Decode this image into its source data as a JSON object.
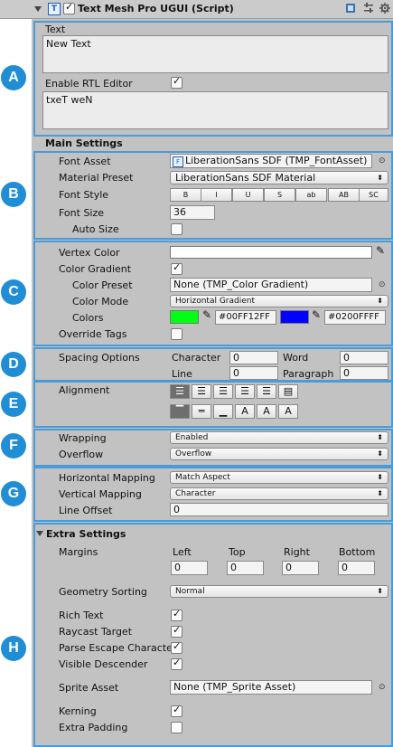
{
  "header": {
    "title": "Text Mesh Pro UGUI (Script)",
    "icon_letter": "T",
    "enabled": true,
    "icons": [
      "book-icon",
      "sliders-icon",
      "gear-icon"
    ]
  },
  "badges": [
    "A",
    "B",
    "C",
    "D",
    "E",
    "F",
    "G",
    "H"
  ],
  "text_section": {
    "label": "Text",
    "text_value": "New Text",
    "rtl_label": "Enable RTL Editor",
    "rtl_enabled": true,
    "rtl_value": "txeT weN"
  },
  "main_settings": {
    "title": "Main Settings",
    "font_asset_label": "Font Asset",
    "font_asset_value": "LiberationSans SDF (TMP_FontAsset)",
    "material_preset_label": "Material Preset",
    "material_preset_value": "LiberationSans SDF Material",
    "font_style_label": "Font Style",
    "font_style_buttons": [
      "B",
      "I",
      "U",
      "S",
      "ab",
      "AB",
      "SC"
    ],
    "font_size_label": "Font Size",
    "font_size_value": "36",
    "auto_size_label": "Auto Size",
    "auto_size": false
  },
  "color_section": {
    "vertex_color_label": "Vertex Color",
    "vertex_color": "#FFFFFF",
    "color_gradient_label": "Color Gradient",
    "color_gradient": true,
    "color_preset_label": "Color Preset",
    "color_preset_value": "None (TMP_Color Gradient)",
    "color_mode_label": "Color Mode",
    "color_mode_value": "Horizontal Gradient",
    "colors_label": "Colors",
    "color1_hex": "#00FF12FF",
    "color1": "#00FF12",
    "color2_hex": "#0200FFFF",
    "color2": "#0200FF",
    "override_tags_label": "Override Tags",
    "override_tags": false
  },
  "spacing": {
    "label": "Spacing Options",
    "character_label": "Character",
    "character_value": "0",
    "word_label": "Word",
    "word_value": "0",
    "line_label": "Line",
    "line_value": "0",
    "paragraph_label": "Paragraph",
    "paragraph_value": "0"
  },
  "alignment": {
    "label": "Alignment",
    "horizontal": [
      "align-left",
      "align-center",
      "align-right",
      "align-justified",
      "align-flush",
      "align-geometry-center"
    ],
    "vertical": [
      "align-top",
      "align-middle",
      "align-bottom",
      "align-baseline",
      "align-midline",
      "align-capline"
    ],
    "selected_horizontal": 0,
    "selected_vertical": 0
  },
  "wrapping": {
    "wrapping_label": "Wrapping",
    "wrapping_value": "Enabled",
    "overflow_label": "Overflow",
    "overflow_value": "Overflow"
  },
  "mapping": {
    "horizontal_label": "Horizontal Mapping",
    "horizontal_value": "Match Aspect",
    "vertical_label": "Vertical Mapping",
    "vertical_value": "Character",
    "line_offset_label": "Line Offset",
    "line_offset_value": "0"
  },
  "extra": {
    "title": "Extra Settings",
    "margins_label": "Margins",
    "left_label": "Left",
    "left_value": "0",
    "top_label": "Top",
    "top_value": "0",
    "right_label": "Right",
    "right_value": "0",
    "bottom_label": "Bottom",
    "bottom_value": "0",
    "geometry_sorting_label": "Geometry Sorting",
    "geometry_sorting_value": "Normal",
    "rich_text_label": "Rich Text",
    "rich_text": true,
    "raycast_label": "Raycast Target",
    "raycast": true,
    "parse_escape_label": "Parse Escape Characte",
    "parse_escape": true,
    "visible_descender_label": "Visible Descender",
    "visible_descender": true,
    "sprite_asset_label": "Sprite Asset",
    "sprite_asset_value": "None (TMP_Sprite Asset)",
    "kerning_label": "Kerning",
    "kerning": true,
    "extra_padding_label": "Extra Padding",
    "extra_padding": false
  }
}
